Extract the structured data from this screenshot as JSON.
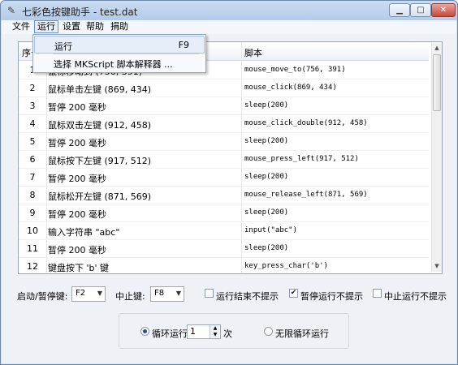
{
  "window": {
    "title": "七彩色按键助手 - test.dat"
  },
  "menubar": {
    "items": [
      "文件",
      "运行",
      "设置",
      "帮助",
      "捐助"
    ]
  },
  "run_menu": {
    "items": [
      {
        "label": "运行",
        "shortcut": "F9"
      },
      {
        "label": "选择 MKScript 脚本解释器 ...",
        "shortcut": ""
      }
    ]
  },
  "table": {
    "headers": [
      "序号",
      "操作",
      "脚本"
    ],
    "rows": [
      {
        "num": "1",
        "op": "鼠标移动到 (756, 391)",
        "script": "mouse_move_to(756, 391)"
      },
      {
        "num": "2",
        "op": "鼠标单击左键 (869, 434)",
        "script": "mouse_click(869, 434)"
      },
      {
        "num": "3",
        "op": "暂停 200 毫秒",
        "script": "sleep(200)"
      },
      {
        "num": "4",
        "op": "鼠标双击左键 (912, 458)",
        "script": "mouse_click_double(912, 458)"
      },
      {
        "num": "5",
        "op": "暂停 200 毫秒",
        "script": "sleep(200)"
      },
      {
        "num": "6",
        "op": "鼠标按下左键 (917, 512)",
        "script": "mouse_press_left(917, 512)"
      },
      {
        "num": "7",
        "op": "暂停 200 毫秒",
        "script": "sleep(200)"
      },
      {
        "num": "8",
        "op": "鼠标松开左键 (871, 569)",
        "script": "mouse_release_left(871, 569)"
      },
      {
        "num": "9",
        "op": "暂停 200 毫秒",
        "script": "sleep(200)"
      },
      {
        "num": "10",
        "op": "输入字符串 \"abc\"",
        "script": "input(\"abc\")"
      },
      {
        "num": "11",
        "op": "暂停 200 毫秒",
        "script": "sleep(200)"
      },
      {
        "num": "12",
        "op": "键盘按下 'b' 键",
        "script": "key_press_char('b')"
      }
    ]
  },
  "controls": {
    "start_stop_label": "启动/暂停键:",
    "start_stop_value": "F2",
    "stop_label": "中止键:",
    "stop_value": "F8",
    "chk_end_label": "运行结束不提示",
    "chk_pause_label": "暂停运行不提示",
    "chk_abort_label": "中止运行不提示",
    "chk_end_checked": false,
    "chk_pause_checked": true,
    "chk_abort_checked": false
  },
  "loop": {
    "loop_label": "循环运行",
    "loop_count": "1",
    "times_label": "次",
    "infinite_label": "无限循环运行",
    "selected": "loop"
  },
  "icons": {
    "app": "pin-icon",
    "minimize": "minimize-icon",
    "maximize": "maximize-icon",
    "close": "close-icon"
  }
}
